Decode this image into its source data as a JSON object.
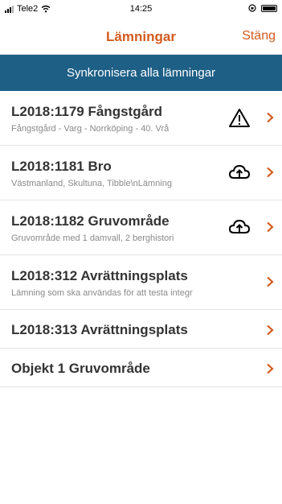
{
  "status_bar": {
    "carrier": "Tele2",
    "time": "14:25"
  },
  "nav": {
    "title": "Lämningar",
    "close_label": "Stäng"
  },
  "sync_button_label": "Synkronisera alla lämningar",
  "items": [
    {
      "title": "L2018:1179 Fångstgård",
      "subtitle": "Fångstgård - Varg - Norrköping - 40. Vrå",
      "status_icon": "warning-icon"
    },
    {
      "title": "L2018:1181 Bro",
      "subtitle": "Västmanland, Skultuna, Tibble\\nLämning",
      "status_icon": "cloud-upload-icon"
    },
    {
      "title": "L2018:1182 Gruvområde",
      "subtitle": "Gruvområde med 1 damvall, 2 berghistori",
      "status_icon": "cloud-upload-icon"
    },
    {
      "title": "L2018:312 Avrättningsplats",
      "subtitle": "Lämning som ska användas för att testa integr",
      "status_icon": ""
    },
    {
      "title": "L2018:313 Avrättningsplats",
      "subtitle": "",
      "status_icon": ""
    },
    {
      "title": "Objekt 1 Gruvområde",
      "subtitle": "",
      "status_icon": ""
    }
  ],
  "colors": {
    "accent": "#d35a1e",
    "sync_bar": "#1e5f86"
  }
}
